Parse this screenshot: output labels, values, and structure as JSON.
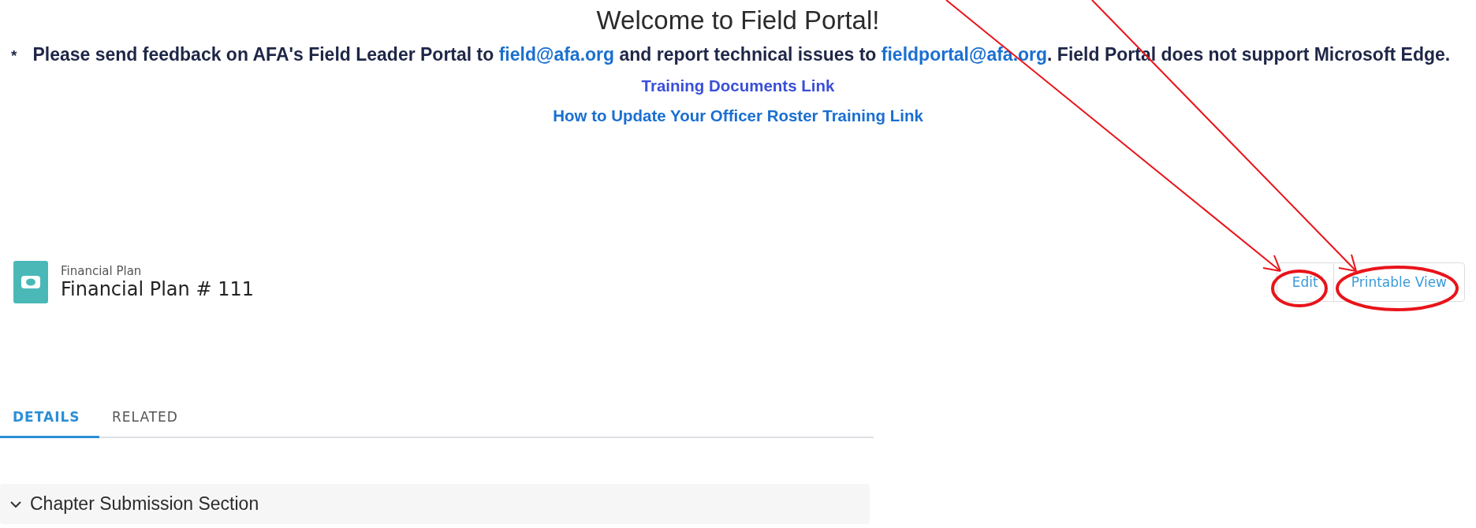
{
  "page_title": "Welcome to Field Portal!",
  "notice": {
    "bullet": "*",
    "parts": [
      {
        "kind": "text",
        "text": "Please send feedback on AFA's Field Leader Portal to "
      },
      {
        "kind": "link",
        "text": "field@afa.org"
      },
      {
        "kind": "text",
        "text": " and report technical issues to "
      },
      {
        "kind": "link",
        "text": "fieldportal@afa.org"
      },
      {
        "kind": "text",
        "text": ". Field Portal does not support Microsoft Edge."
      }
    ]
  },
  "links": [
    {
      "label": "Training Documents Link",
      "visited": true
    },
    {
      "label": "How to Update Your Officer Roster Training Link",
      "visited": false
    }
  ],
  "record": {
    "type_label": "Financial Plan",
    "title": "Financial Plan # 111"
  },
  "buttons": [
    {
      "label": "Edit"
    },
    {
      "label": "Printable View"
    }
  ],
  "tabs": [
    {
      "label": "DETAILS",
      "selected": true
    },
    {
      "label": "RELATED",
      "selected": false
    }
  ],
  "section": {
    "label": "Chapter Submission Section",
    "expanded": true
  }
}
